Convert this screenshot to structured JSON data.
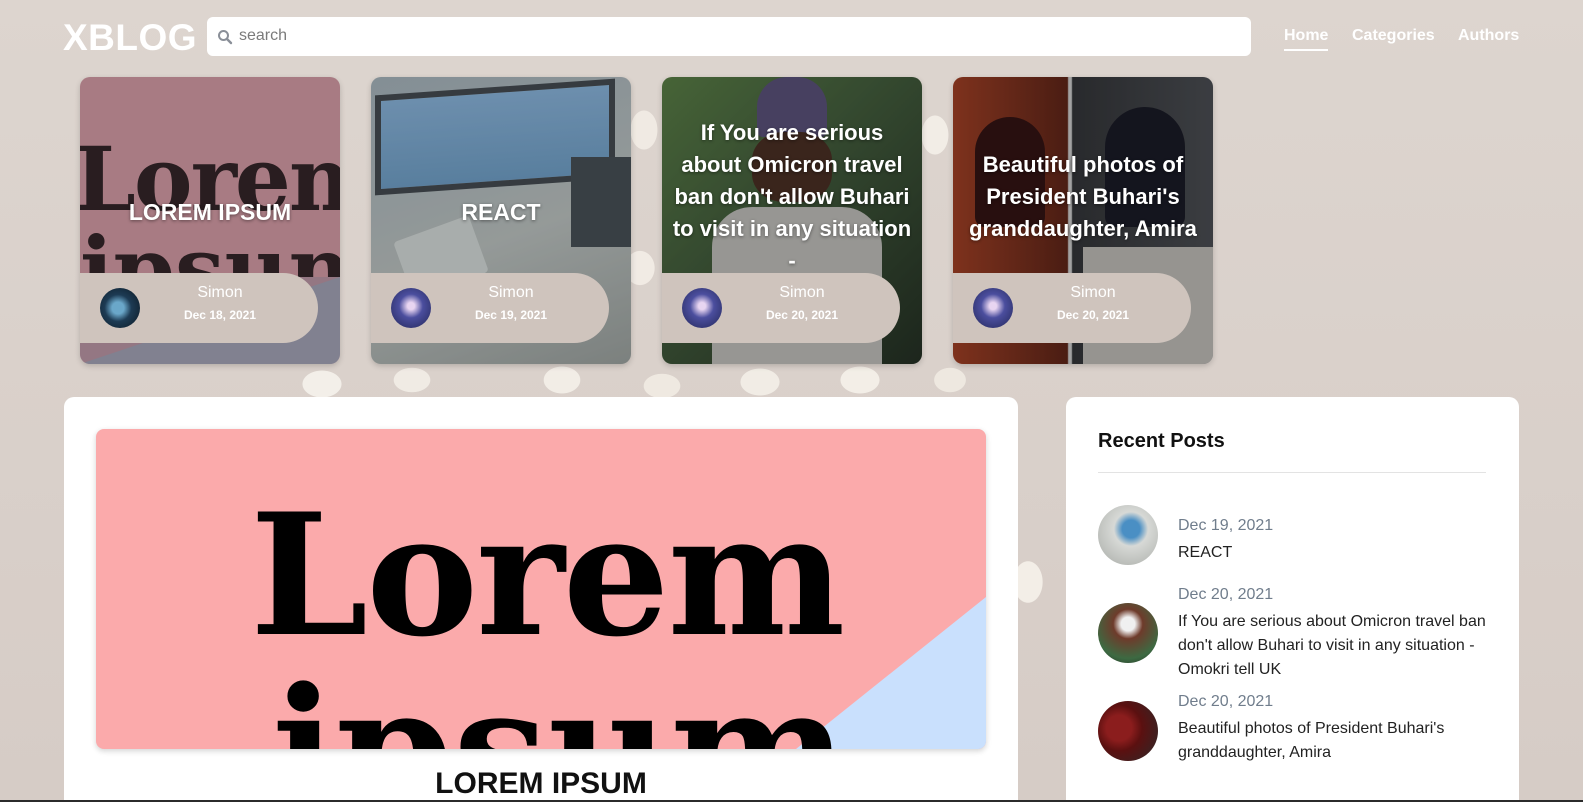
{
  "header": {
    "logo": "XBLOG",
    "search_placeholder": "search",
    "nav": {
      "home": "Home",
      "categories": "Categories",
      "authors": "Authors"
    },
    "active_nav": "Home"
  },
  "carousel": [
    {
      "title": "LOREM IPSUM",
      "author": "Simon",
      "date": "Dec 18, 2021"
    },
    {
      "title": "REACT",
      "author": "Simon",
      "date": "Dec 19, 2021"
    },
    {
      "title": "If You are serious about Omicron travel ban don't allow Buhari to visit in any situation -",
      "author": "Simon",
      "date": "Dec 20, 2021"
    },
    {
      "title": "Beautiful photos of President Buhari's granddaughter, Amira",
      "author": "Simon",
      "date": "Dec 20, 2021"
    }
  ],
  "main_post": {
    "hero_text_line1": "Lorem",
    "hero_text_line2": "ipsum",
    "title": "LOREM IPSUM"
  },
  "sidebar": {
    "title": "Recent Posts",
    "posts": [
      {
        "date": "Dec 19, 2021",
        "title": "REACT"
      },
      {
        "date": "Dec 20, 2021",
        "title": "If You are serious about Omicron travel ban don't allow Buhari to visit in any situation - Omokri tell UK"
      },
      {
        "date": "Dec 20, 2021",
        "title": "Beautiful photos of President Buhari's granddaughter, Amira"
      }
    ]
  },
  "colors": {
    "background": "#dcd3cd",
    "pill": "#cfc4bd",
    "hero_pink": "#fbaaab",
    "hero_blue": "#c9e0fd",
    "date_grey": "#707d8c"
  }
}
